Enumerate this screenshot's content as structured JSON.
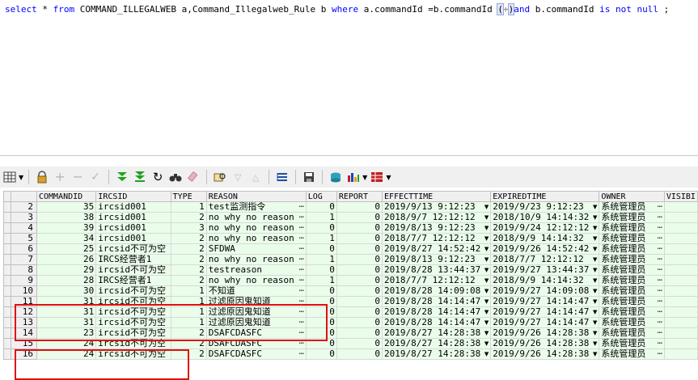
{
  "sql": {
    "p1": "select",
    "p2": " * ",
    "p3": "from",
    "p4": " COMMAND_ILLEGALWEB a,Command_Illegalweb_Rule b ",
    "p5": "where",
    "p6": " a.commandId =b.commandId ",
    "p7": "(",
    "p8": "+",
    "p9": ")",
    "p10": "and",
    "p11": " b.commandId ",
    "p12": "is not null",
    "p13": " ;"
  },
  "toolbar": {
    "icons": [
      "grid-options-icon",
      "lock-icon",
      "add-record-icon",
      "delete-record-icon",
      "post-changes-icon",
      "fetch-next-icon",
      "fetch-last-icon",
      "refresh-icon",
      "find-icon",
      "clear-icon",
      "query-by-example-icon",
      "filter-icon",
      "sort-icon",
      "record-view-icon",
      "save-icon",
      "export-icon",
      "chart-icon",
      "table-icon"
    ]
  },
  "grid": {
    "columns": [
      "COMMANDID",
      "IRCSID",
      "TYPE",
      "REASON",
      "LOG",
      "REPORT",
      "EFFECTTIME",
      "EXPIREDTIME",
      "OWNER",
      "VISIBI"
    ],
    "rows": [
      {
        "rn": "2",
        "commandid": "35",
        "ircsid": "ircsid001",
        "type": "1",
        "reason": "test监测指令",
        "log": "0",
        "report": "0",
        "effect": "2019/9/13 9:12:23",
        "expired": "2019/9/23 9:12:23",
        "owner": "系统管理员"
      },
      {
        "rn": "3",
        "commandid": "38",
        "ircsid": "ircsid001",
        "type": "2",
        "reason": "no why no reason",
        "log": "1",
        "report": "0",
        "effect": "2018/9/7 12:12:12",
        "expired": "2018/10/9 14:14:32",
        "owner": "系统管理员"
      },
      {
        "rn": "4",
        "commandid": "39",
        "ircsid": "ircsid001",
        "type": "3",
        "reason": "no why no reason",
        "log": "0",
        "report": "0",
        "effect": "2019/8/13 9:12:23",
        "expired": "2019/9/24 12:12:12",
        "owner": "系统管理员"
      },
      {
        "rn": "5",
        "commandid": "34",
        "ircsid": "ircsid001",
        "type": "2",
        "reason": "no why no reason",
        "log": "1",
        "report": "0",
        "effect": "2018/7/7 12:12:12",
        "expired": "2018/9/9 14:14:32",
        "owner": "系统管理员"
      },
      {
        "rn": "6",
        "commandid": "25",
        "ircsid": "ircsid不可为空",
        "type": "2",
        "reason": "SFDWA",
        "log": "0",
        "report": "0",
        "effect": "2019/8/27 14:52:42",
        "expired": "2019/9/26 14:52:42",
        "owner": "系统管理员"
      },
      {
        "rn": "7",
        "commandid": "26",
        "ircsid": "IRCS经营者1",
        "type": "2",
        "reason": "no why no reason",
        "log": "1",
        "report": "0",
        "effect": "2019/8/13 9:12:23",
        "expired": "2018/7/7 12:12:12",
        "owner": "系统管理员"
      },
      {
        "rn": "8",
        "commandid": "29",
        "ircsid": "ircsid不可为空",
        "type": "2",
        "reason": "testreason",
        "log": "0",
        "report": "0",
        "effect": "2019/8/28 13:44:37",
        "expired": "2019/9/27 13:44:37",
        "owner": "系统管理员"
      },
      {
        "rn": "9",
        "commandid": "28",
        "ircsid": "IRCS经营者1",
        "type": "2",
        "reason": "no why no reason",
        "log": "1",
        "report": "0",
        "effect": "2018/7/7 12:12:12",
        "expired": "2018/9/9 14:14:32",
        "owner": "系统管理员"
      },
      {
        "rn": "10",
        "commandid": "30",
        "ircsid": "ircsid不可为空",
        "type": "1",
        "reason": "不知道",
        "log": "0",
        "report": "0",
        "effect": "2019/8/28 14:09:08",
        "expired": "2019/9/27 14:09:08",
        "owner": "系统管理员"
      },
      {
        "rn": "11",
        "commandid": "31",
        "ircsid": "ircsid不可为空",
        "type": "1",
        "reason": "过滤原因鬼知道",
        "log": "0",
        "report": "0",
        "effect": "2019/8/28 14:14:47",
        "expired": "2019/9/27 14:14:47",
        "owner": "系统管理员"
      },
      {
        "rn": "12",
        "commandid": "31",
        "ircsid": "ircsid不可为空",
        "type": "1",
        "reason": "过滤原因鬼知道",
        "log": "0",
        "report": "0",
        "effect": "2019/8/28 14:14:47",
        "expired": "2019/9/27 14:14:47",
        "owner": "系统管理员"
      },
      {
        "rn": "13",
        "commandid": "31",
        "ircsid": "ircsid不可为空",
        "type": "1",
        "reason": "过滤原因鬼知道",
        "log": "0",
        "report": "0",
        "effect": "2019/8/28 14:14:47",
        "expired": "2019/9/27 14:14:47",
        "owner": "系统管理员"
      },
      {
        "rn": "14",
        "commandid": "23",
        "ircsid": "ircsid不可为空",
        "type": "2",
        "reason": "DSAFCDASFC",
        "log": "0",
        "report": "0",
        "effect": "2019/8/27 14:28:38",
        "expired": "2019/9/26 14:28:38",
        "owner": "系统管理员"
      },
      {
        "rn": "15",
        "commandid": "24",
        "ircsid": "ircsid不可为空",
        "type": "2",
        "reason": "DSAFCDASFC",
        "log": "0",
        "report": "0",
        "effect": "2019/8/27 14:28:38",
        "expired": "2019/9/26 14:28:38",
        "owner": "系统管理员"
      },
      {
        "rn": "16",
        "commandid": "24",
        "ircsid": "ircsid不可为空",
        "type": "2",
        "reason": "DSAFCDASFC",
        "log": "0",
        "report": "0",
        "effect": "2019/8/27 14:28:38",
        "expired": "2019/9/26 14:28:38",
        "owner": "系统管理员"
      }
    ],
    "highlight_color": "#e01010"
  }
}
